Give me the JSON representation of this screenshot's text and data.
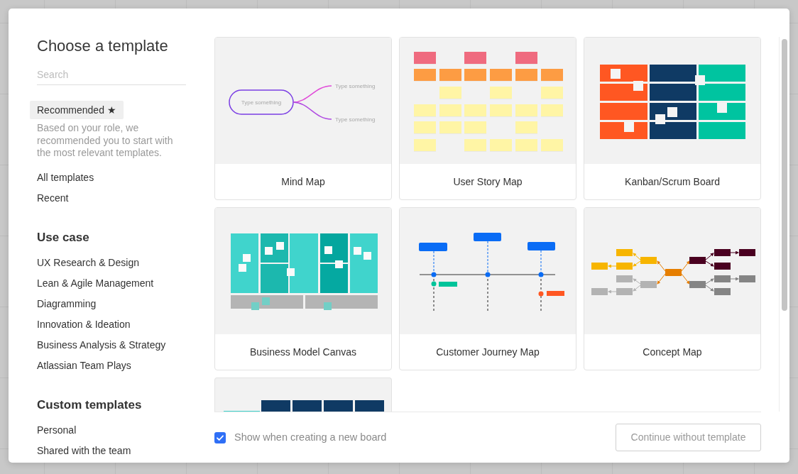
{
  "dialog": {
    "title": "Choose a template"
  },
  "search": {
    "placeholder": "Search"
  },
  "sidebar": {
    "items": [
      {
        "label": "Recommended ★",
        "selected": true,
        "description": "Based on your role, we recommended you to start with the most relevant templates."
      },
      {
        "label": "All templates",
        "selected": false
      },
      {
        "label": "Recent",
        "selected": false
      }
    ],
    "sections": [
      {
        "heading": "Use case",
        "items": [
          {
            "label": "UX Research & Design",
            "selected": false
          },
          {
            "label": "Lean & Agile Management",
            "selected": false
          },
          {
            "label": "Diagramming",
            "selected": false
          },
          {
            "label": "Innovation & Ideation",
            "selected": false
          },
          {
            "label": "Business Analysis & Strategy",
            "selected": false
          },
          {
            "label": "Atlassian Team Plays",
            "selected": false
          }
        ]
      },
      {
        "heading": "Custom templates",
        "items": [
          {
            "label": "Personal",
            "selected": false
          },
          {
            "label": "Shared with the team",
            "selected": false
          }
        ]
      }
    ]
  },
  "templates": [
    {
      "name": "Mind Map",
      "kind": "mind_map",
      "node_labels": [
        "Type something",
        "Type something",
        "Type something"
      ]
    },
    {
      "name": "User Story Map",
      "kind": "story_map"
    },
    {
      "name": "Kanban/Scrum Board",
      "kind": "kanban"
    },
    {
      "name": "Business Model Canvas",
      "kind": "canvas"
    },
    {
      "name": "Customer Journey Map",
      "kind": "journey"
    },
    {
      "name": "Concept Map",
      "kind": "concept"
    },
    {
      "kind": "table"
    }
  ],
  "footer": {
    "checkbox": {
      "label": "Show when creating a new board",
      "checked": true
    },
    "button": {
      "label": "Continue without template"
    }
  }
}
